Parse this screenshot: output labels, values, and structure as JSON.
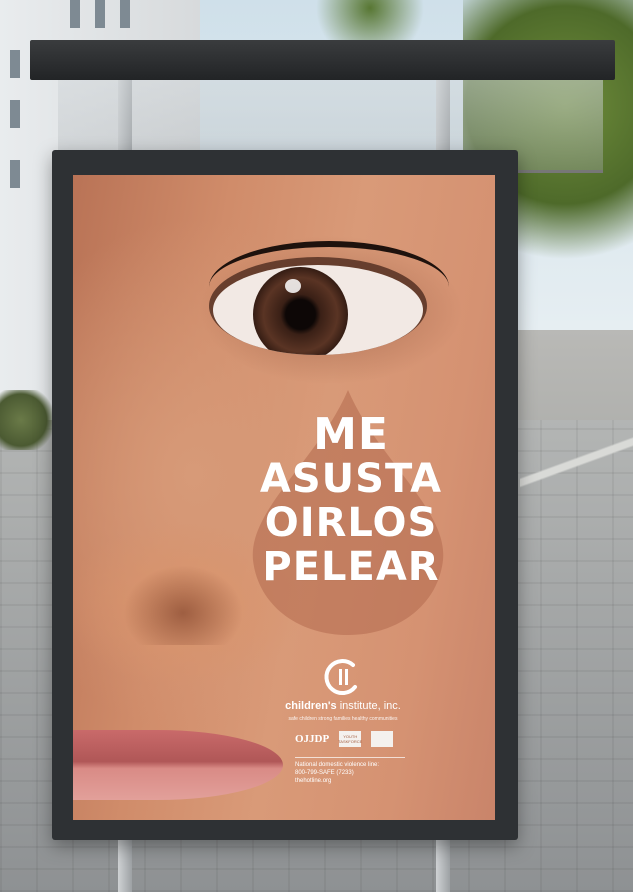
{
  "poster": {
    "headline": [
      "ME",
      "ASUSTA",
      "OIRLOS",
      "PELEAR"
    ],
    "org_name_bold": "children's",
    "org_name_rest": " institute, inc.",
    "tagline": "safe children strong families healthy communities",
    "partners": [
      "OJJDP",
      "YOUTH TASKFORCE",
      ""
    ],
    "hotline_label": "National domestic violence line:",
    "hotline_phone": "800-799-SAFE (7233)",
    "hotline_url": "thehotline.org"
  },
  "colors": {
    "skin": "#d59272",
    "frame": "#2e3134",
    "text": "#ffffff"
  },
  "icons": [
    "childrens-institute-logo-icon",
    "teardrop-shape"
  ]
}
